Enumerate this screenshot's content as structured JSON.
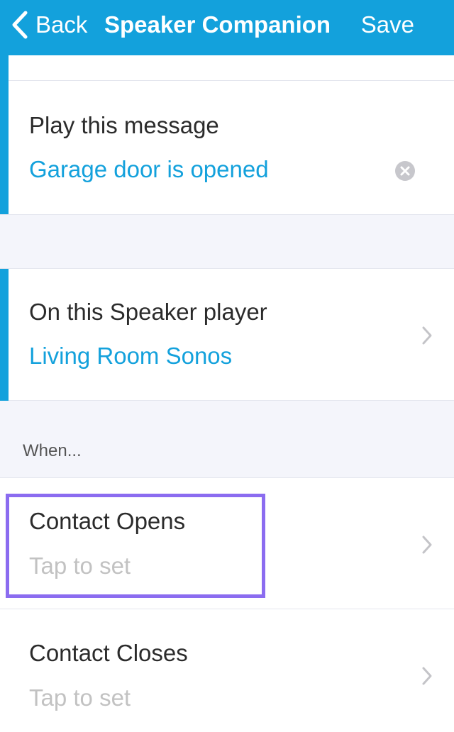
{
  "navbar": {
    "back_label": "Back",
    "title": "Speaker Companion",
    "save_label": "Save"
  },
  "message": {
    "label": "Play this message",
    "value": "Garage door is opened"
  },
  "speaker": {
    "label": "On this Speaker player",
    "value": "Living Room Sonos"
  },
  "when_section": {
    "header": "When...",
    "items": [
      {
        "label": "Contact Opens",
        "value": "Tap to set"
      },
      {
        "label": "Contact Closes",
        "value": "Tap to set"
      }
    ]
  },
  "colors": {
    "accent": "#13a1dc",
    "highlight": "#8b6cf0"
  }
}
